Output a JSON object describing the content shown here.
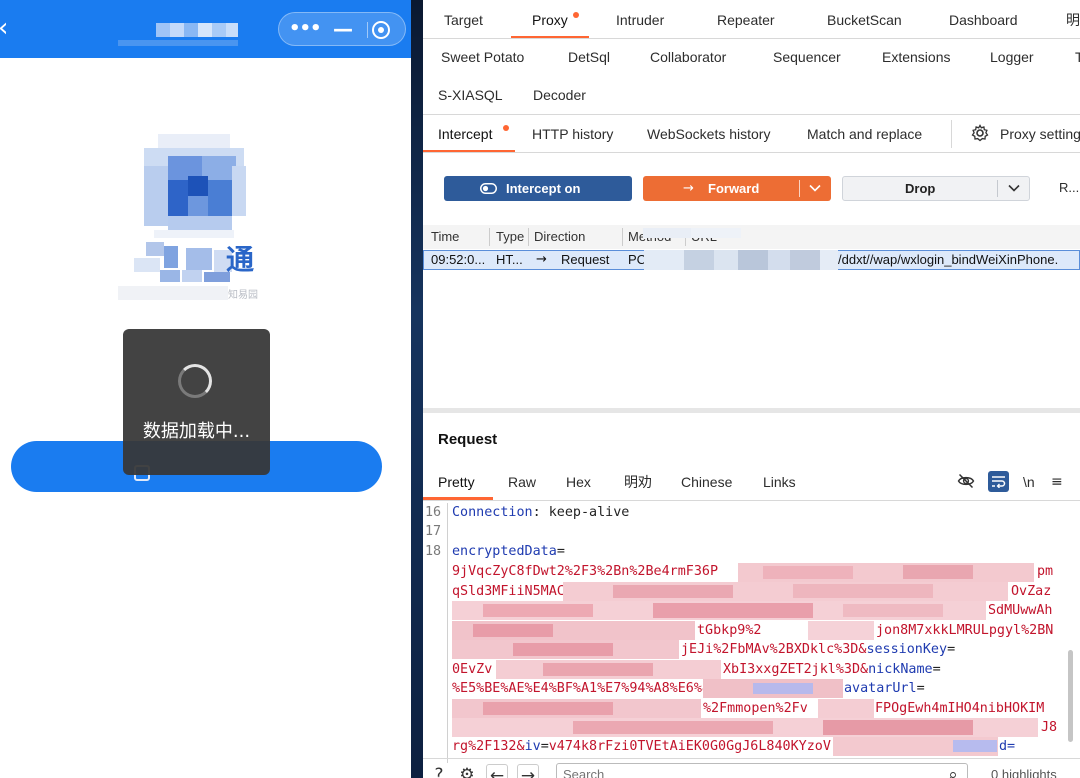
{
  "phone": {
    "back_icon": "‹",
    "capsule": {
      "more_icon": "•••",
      "minimize_icon": "—"
    },
    "logo_char": "通",
    "logo_subtext": "知易园",
    "loading_text": "数据加载中..."
  },
  "burp": {
    "main_tabs": [
      "Target",
      "Proxy",
      "Intruder",
      "Repeater",
      "BucketScan",
      "Dashboard",
      "明"
    ],
    "ext_tabs_row1": [
      "Sweet Potato",
      "DetSql",
      "Collaborator",
      "Sequencer",
      "Extensions",
      "Logger",
      "T"
    ],
    "ext_tabs_row2": [
      "S-XIASQL",
      "Decoder"
    ],
    "proxy_tabs": [
      "Intercept",
      "HTTP history",
      "WebSockets history",
      "Match and replace"
    ],
    "proxy_settings_label": "Proxy setting",
    "actions": {
      "intercept_label": "Intercept on",
      "forward_label": "Forward",
      "drop_label": "Drop",
      "more_label": "R..."
    },
    "table": {
      "headers": [
        "Time",
        "Type",
        "Direction",
        "Method",
        "URL"
      ],
      "rows": [
        {
          "time": "09:52:0...",
          "type": "HT...",
          "direction_arrow": "→",
          "direction": "Request",
          "method": "PC",
          "url": "/ddxt//wap/wxlogin_bindWeiXinPhone."
        }
      ]
    },
    "request": {
      "title": "Request",
      "tabs": [
        "Pretty",
        "Raw",
        "Hex",
        "明劝",
        "Chinese",
        "Links"
      ],
      "newline_toggle": "\\n",
      "lines": {
        "l16_num": "16",
        "l16_key": "Connection",
        "l16_sep": ": ",
        "l16_val": "keep-alive",
        "l17_num": "17",
        "l18_num": "18",
        "l18_key": "encryptedData",
        "l18_eq": "=",
        "w1": "9jVqcZyC8fDwt2%2F3%2Bn%2Be4rmF36P",
        "w1_end": "pm",
        "w2": "qSld3MFiiN5MAC",
        "w2_end": "OvZaz",
        "w3_end": "SdMUwwAh",
        "w4": "tGbkp9%2",
        "w4_end": "jon8M7xkkLMRULpgyl%2BN",
        "w5": "jEJi%2FbMAv%2BXDklc%3D&",
        "w5_key": "sessionKey",
        "w5_eq": "=",
        "w6": "0EvZv",
        "w6_mid": "XbI3xxgZET2jkl%3D&",
        "w6_key": "nickName",
        "w6_eq": "=",
        "w7": "%E5%BE%AE%E4%BF%A1%E7%94%A8%E6%88",
        "w7_key": "avatarUrl",
        "w7_eq": "=",
        "w8_mid": "%2Fmmopen%2Fv",
        "w8_end": "FPOgEwh4mIHO4nibHOKIM",
        "w9_end": "J8",
        "w10": "rg%2F132&",
        "w10_key": "iv",
        "w10_eq": "=",
        "w10_val": "v474k8rFzi0TVEtAiEK0G0GgJ6L840KYzoV",
        "w10_tail": "d="
      }
    },
    "footer": {
      "search_placeholder": "Search",
      "highlights": "0 highlights"
    }
  }
}
